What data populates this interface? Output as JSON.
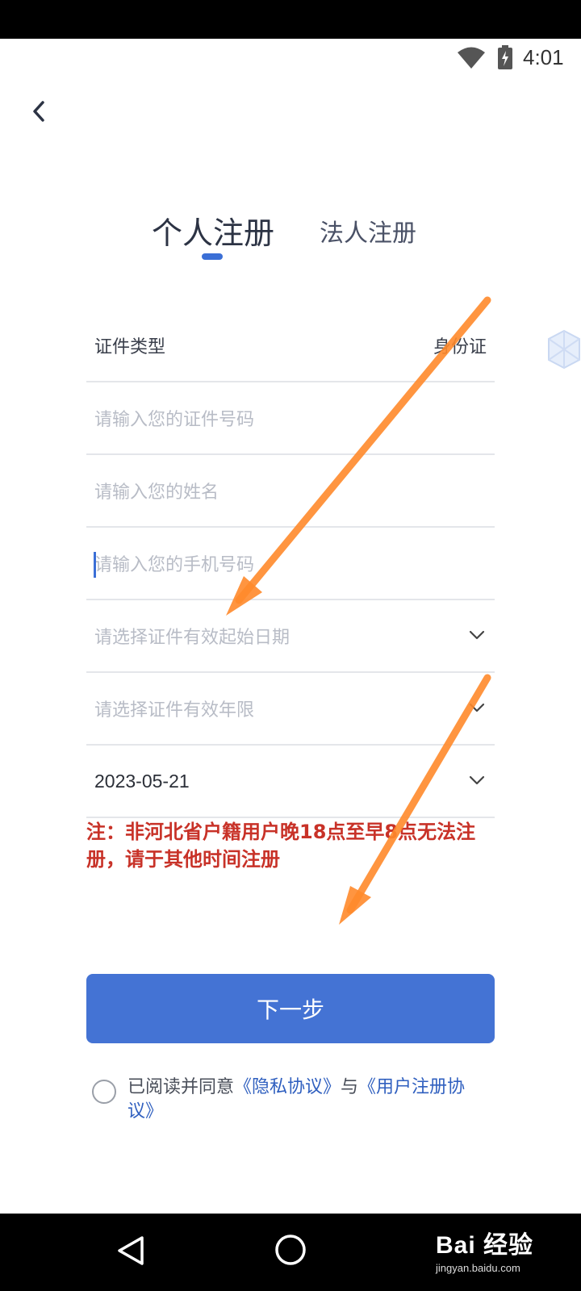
{
  "status_bar": {
    "time": "4:01",
    "wifi_icon": "wifi-icon",
    "battery_icon": "battery-charging-icon"
  },
  "header": {
    "back_icon": "chevron-left-icon"
  },
  "tabs": [
    {
      "label": "个人注册",
      "active": true
    },
    {
      "label": "法人注册",
      "active": false
    }
  ],
  "form": {
    "id_type": {
      "label": "证件类型",
      "value": "身份证"
    },
    "id_number": {
      "placeholder": "请输入您的证件号码"
    },
    "name": {
      "placeholder": "请输入您的姓名"
    },
    "phone": {
      "placeholder": "请输入您的手机号码"
    },
    "id_start_date": {
      "placeholder": "请选择证件有效起始日期"
    },
    "id_validity": {
      "placeholder": "请选择证件有效年限"
    },
    "date_value": "2023-05-21"
  },
  "notice": "注：非河北省户籍用户晚18点至早8点无法注册，请于其他时间注册",
  "next_button": "下一步",
  "agreement": {
    "prefix": "已阅读并同意",
    "privacy_link": "《隐私协议》",
    "joiner": "与",
    "user_link": "《用户注册协议》"
  },
  "colors": {
    "accent": "#4473d4",
    "warning": "#c83228",
    "arrow": "#ff8a2b"
  },
  "watermark": {
    "main": "Bai 经验",
    "sub": "jingyan.baidu.com"
  }
}
